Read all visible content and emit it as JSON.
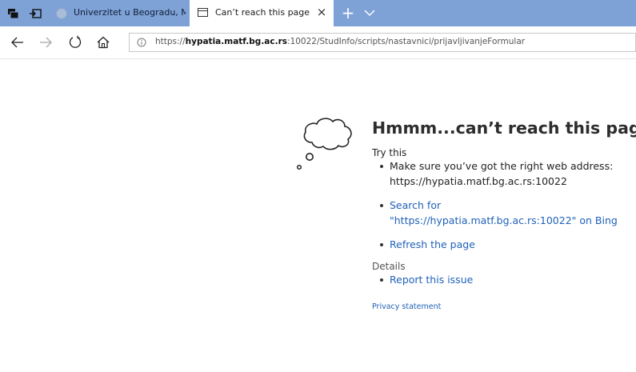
{
  "tabbar": {
    "inactive_tab_title": "Univerzitet u Beogradu, Ma",
    "active_tab_title": "Can’t reach this page",
    "close_glyph": "×",
    "new_tab_glyph": "+"
  },
  "navbar": {
    "url_prefix": "https://",
    "url_host": "hypatia.matf.bg.ac.rs",
    "url_rest": ":10022/StudInfo/scripts/nastavnici/prijavljivanjeFormular"
  },
  "error": {
    "title": "Hmmm...can’t reach this page",
    "try_this": "Try this",
    "tips": [
      "Make sure you’ve got the right web address: https://hypatia.matf.bg.ac.rs:10022",
      "Search for \"https://hypatia.matf.bg.ac.rs:10022\" on Bing",
      "Refresh the page"
    ],
    "details_heading": "Details",
    "report_issue": "Report this issue",
    "privacy_statement": "Privacy statement"
  },
  "colors": {
    "tabbar_bg": "#7ea1d6",
    "link": "#1f61b8"
  },
  "icons": {
    "tabbar": [
      "tabs-aside-icon",
      "restore-tabs-icon",
      "site-favicon",
      "page-icon",
      "close-icon",
      "plus-icon",
      "chevron-down-icon"
    ],
    "navbar": [
      "back-arrow-icon",
      "forward-arrow-icon",
      "refresh-icon",
      "home-icon",
      "info-icon"
    ],
    "content": "thought-cloud-icon"
  }
}
